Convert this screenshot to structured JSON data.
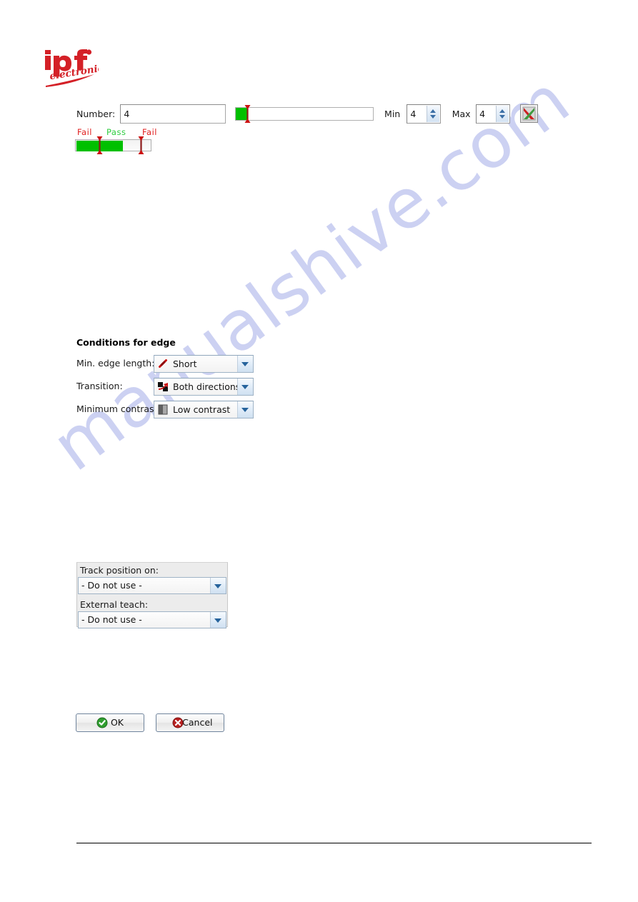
{
  "logo": {
    "name": "ipf electronic",
    "primary_text": "ipf",
    "secondary_text": "electronic",
    "color": "#d42027"
  },
  "watermark": {
    "text": "manualshive.com",
    "color": "#ccd1f2"
  },
  "number_row": {
    "label": "Number:",
    "value": "4",
    "placeholder": "",
    "slider": {
      "fill_percent": 8,
      "marker_percent": 8,
      "fill_color": "#00c000"
    },
    "min": {
      "label": "Min",
      "value": "4"
    },
    "max": {
      "label": "Max",
      "value": "4"
    },
    "clear_button": {
      "icon": "red-green-x-icon",
      "tooltip": ""
    }
  },
  "gauge": {
    "legend_left": "Fail",
    "legend_center": "Pass",
    "legend_right": "Fail",
    "fail_color": "#e02020",
    "pass_color": "#2ecc40",
    "fill_percent": 62,
    "marker_low_percent": 30,
    "marker_high_percent": 83,
    "fill_color": "#00c000"
  },
  "conditions": {
    "title": "Conditions for edge",
    "rows": [
      {
        "label": "Min. edge length:",
        "value": "Short",
        "icon": "short-edge-icon"
      },
      {
        "label": "Transition:",
        "value": "Both directions",
        "icon": "both-directions-icon"
      },
      {
        "label": "Minimum contrast:",
        "value": "Low contrast",
        "icon": "low-contrast-icon"
      }
    ]
  },
  "track_panel": {
    "track_label": "Track position on:",
    "track_value": "- Do not use -",
    "teach_label": "External teach:",
    "teach_value": "- Do not use -"
  },
  "footer_buttons": {
    "ok_label": "OK",
    "cancel_label": "Cancel"
  }
}
